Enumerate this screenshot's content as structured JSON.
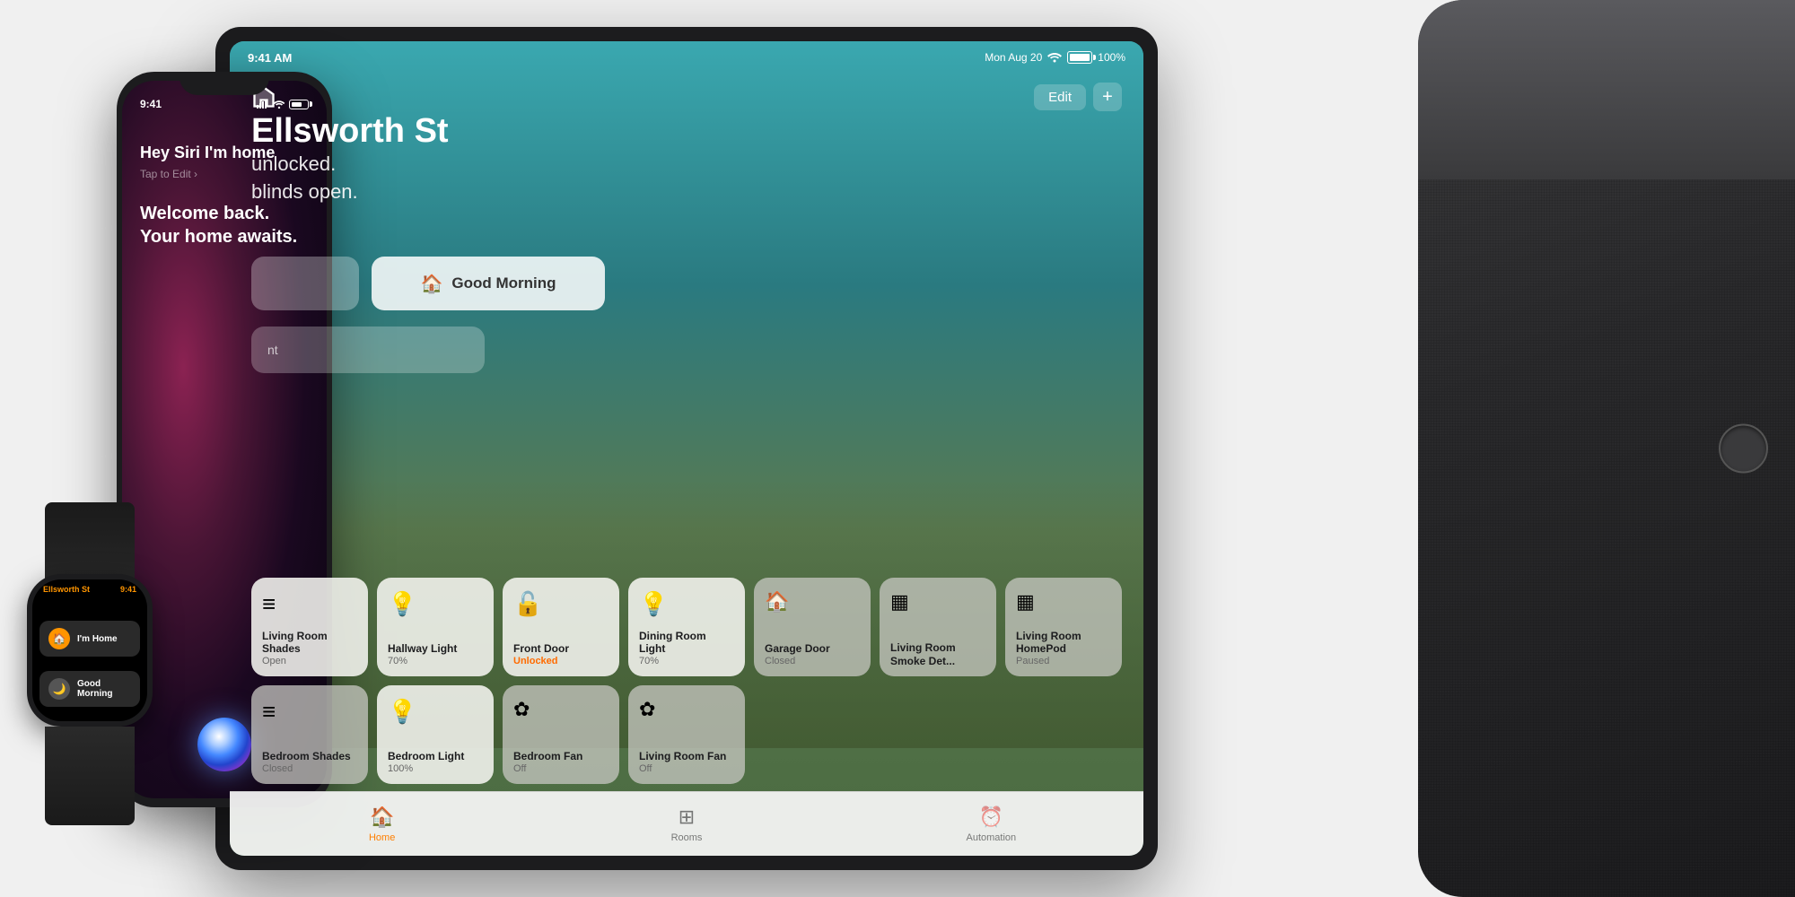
{
  "ipad": {
    "statusbar": {
      "time": "9:41 AM",
      "date": "Mon Aug 20",
      "battery": "100%"
    },
    "header": {
      "edit_label": "Edit",
      "plus_label": "+"
    },
    "home": {
      "name": "Ellsworth St",
      "subtitle_line1": "unlocked.",
      "subtitle_line2": "blinds open."
    },
    "scenes": [
      {
        "label": "Good Morning",
        "icon": "🏠"
      }
    ],
    "tiles": [
      {
        "name": "Living Room Shades",
        "status": "Open",
        "icon": "≡",
        "state": "active"
      },
      {
        "name": "Hallway Light",
        "status": "70%",
        "icon": "💡",
        "state": "active"
      },
      {
        "name": "Front Door",
        "status": "Unlocked",
        "icon": "🔓",
        "state": "unlocked"
      },
      {
        "name": "Dining Room Light",
        "status": "70%",
        "icon": "💡",
        "state": "active"
      },
      {
        "name": "Garage Door",
        "status": "Closed",
        "icon": "🏠",
        "state": "inactive"
      },
      {
        "name": "Living Room Smoke Det...",
        "status": "",
        "icon": "▦",
        "state": "inactive"
      },
      {
        "name": "Living Room HomePod",
        "status": "Paused",
        "icon": "▦",
        "state": "inactive"
      },
      {
        "name": "Bedroom Shades",
        "status": "Closed",
        "icon": "≡",
        "state": "inactive"
      },
      {
        "name": "Bedroom Light",
        "status": "100%",
        "icon": "💡",
        "state": "active"
      },
      {
        "name": "Bedroom Fan",
        "status": "Off",
        "icon": "✿",
        "state": "inactive"
      },
      {
        "name": "Living Room Fan",
        "status": "Off",
        "icon": "✿",
        "state": "inactive"
      }
    ],
    "tabbar": {
      "tabs": [
        {
          "label": "Home",
          "icon": "🏠",
          "active": true
        },
        {
          "label": "Rooms",
          "icon": "⊞",
          "active": false
        },
        {
          "label": "Automation",
          "icon": "⏰",
          "active": false
        }
      ]
    }
  },
  "iphone": {
    "statusbar": {
      "time": "9:41"
    },
    "siri": {
      "query": "Hey Siri I'm home",
      "tap_label": "Tap to Edit ›",
      "response": "Welcome back. Your home awaits."
    }
  },
  "watch": {
    "statusbar": {
      "location": "Ellsworth St",
      "time": "9:41"
    },
    "cards": [
      {
        "label": "I'm Home",
        "icon": "🏠",
        "type": "orange"
      },
      {
        "label": "Good Morning",
        "icon": "🌙",
        "type": "gray"
      }
    ]
  }
}
